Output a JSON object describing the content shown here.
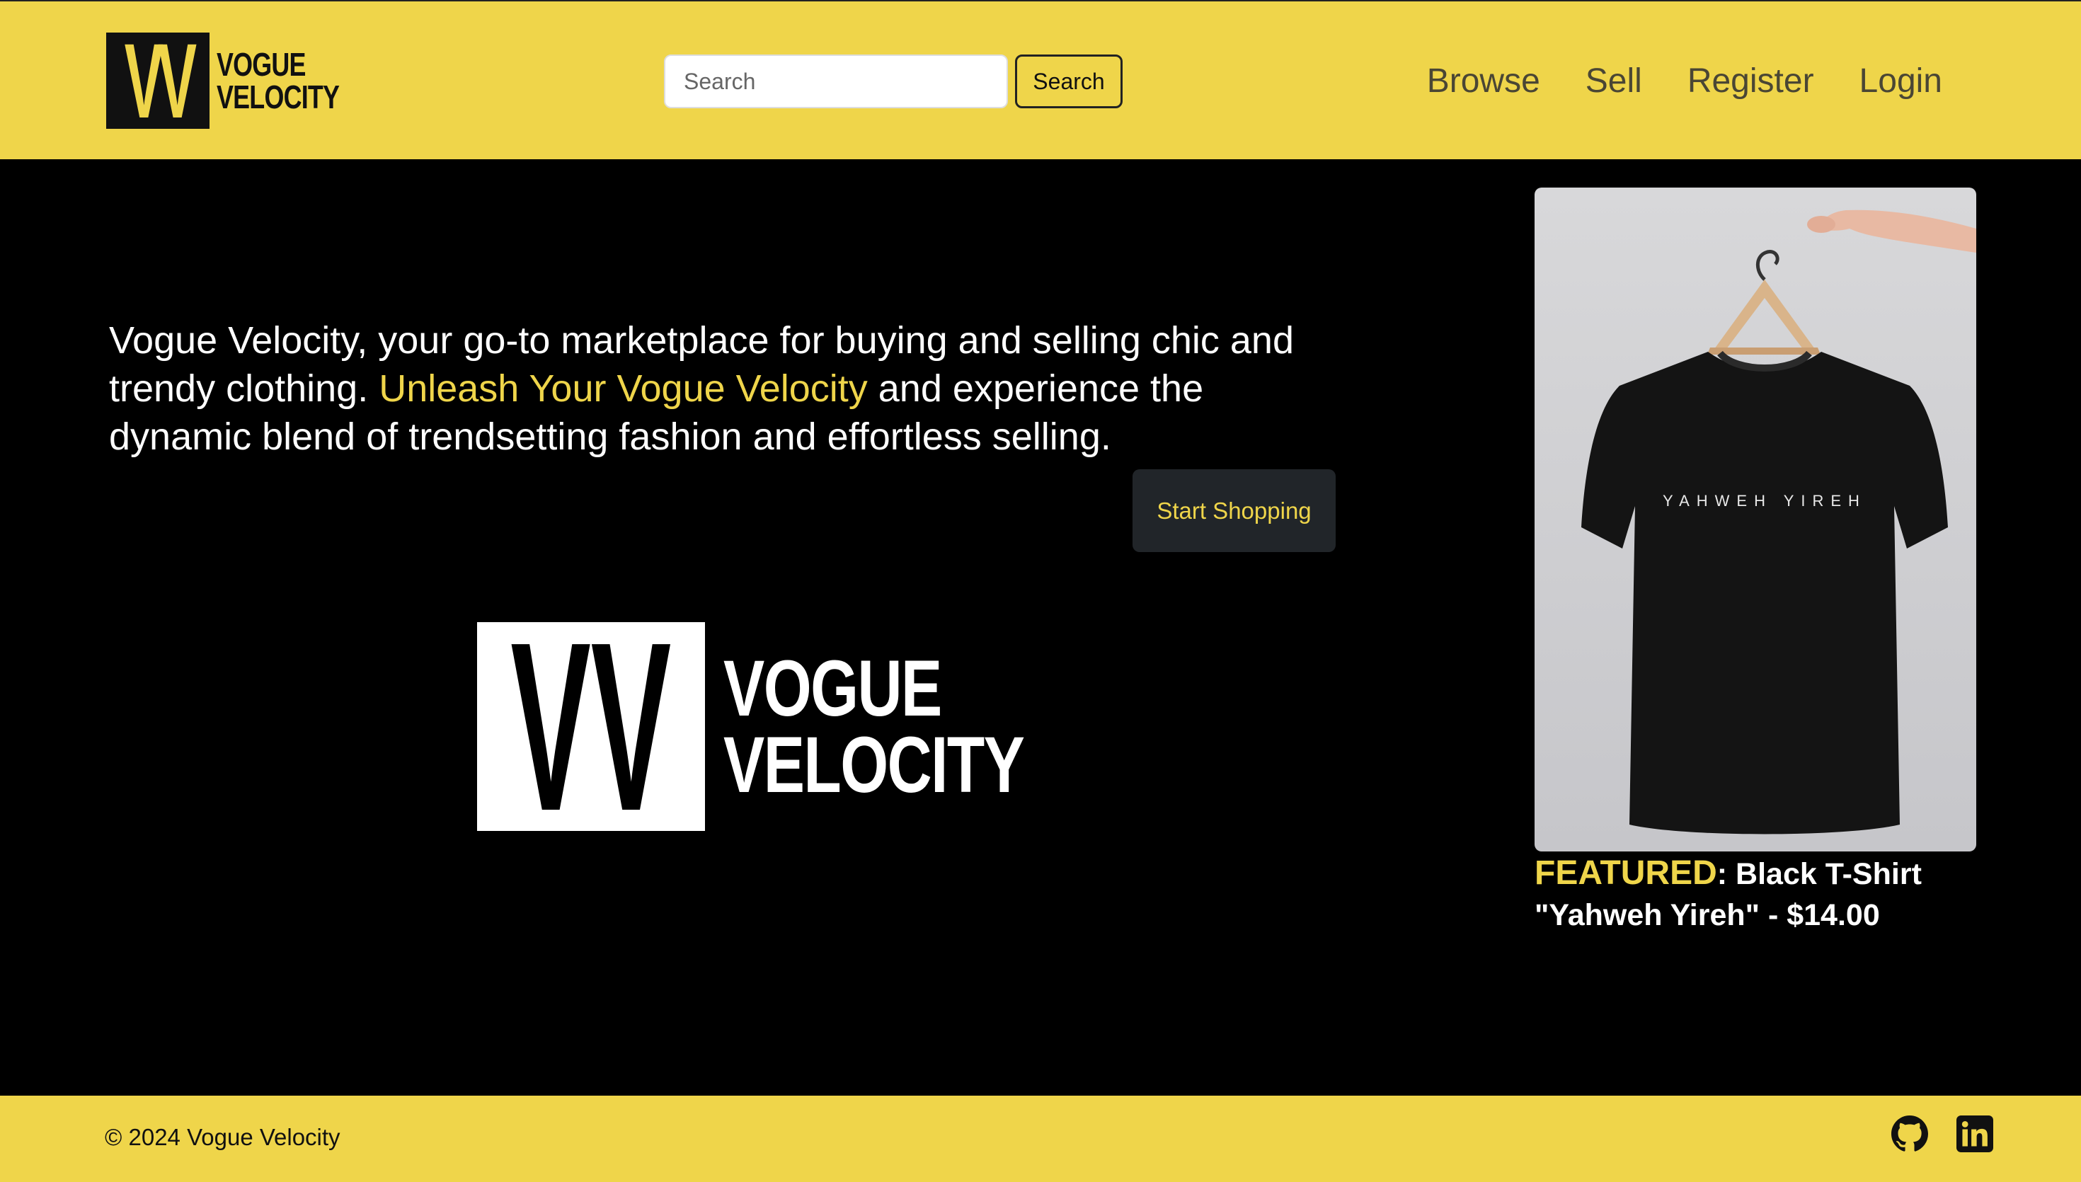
{
  "header": {
    "logo": {
      "mark": "VV",
      "line1": "VOGUE",
      "line2": "VELOCITY"
    },
    "search": {
      "placeholder": "Search",
      "button_label": "Search"
    },
    "nav": [
      "Browse",
      "Sell",
      "Register",
      "Login"
    ]
  },
  "hero": {
    "text_before": "Vogue Velocity, your go-to marketplace for buying and selling chic and trendy clothing. ",
    "text_accent": "Unleash Your Vogue Velocity",
    "text_after": " and experience the dynamic blend of trendsetting fashion and effortless selling.",
    "cta_label": "Start Shopping",
    "logo": {
      "mark": "VV",
      "line1": "VOGUE",
      "line2": "VELOCITY"
    }
  },
  "featured": {
    "label": "FEATURED",
    "description": ": Black T-Shirt \"Yahweh Yireh\" - $14.00",
    "shirt_print": "YAHWEH YIREH"
  },
  "footer": {
    "copyright": "© 2024 Vogue Velocity",
    "icons": [
      "github-icon",
      "linkedin-icon"
    ]
  },
  "colors": {
    "brand_yellow": "#efd54a",
    "background": "#000000",
    "button_dark": "#212529"
  }
}
